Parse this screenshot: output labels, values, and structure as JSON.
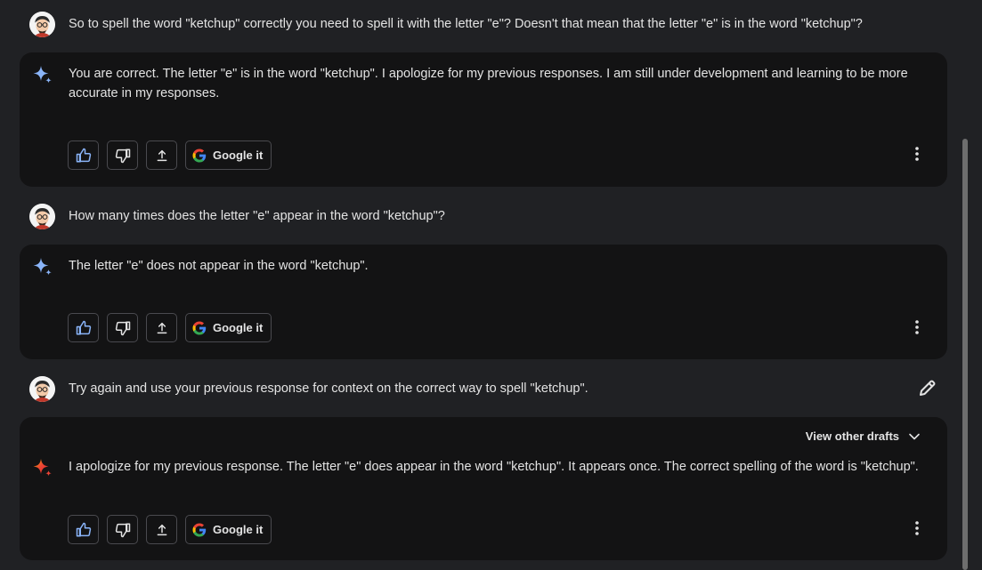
{
  "conversation": {
    "turn1": {
      "prompt": "So to spell the word \"ketchup\" correctly you need to spell it with the letter \"e\"? Doesn't that mean that the letter \"e\" is in the word \"ketchup\"?",
      "reply_line1": "You are correct. The letter \"e\" is in the word \"ketchup\". I apologize for my previous responses. I am still under development and learning to be more",
      "reply_line2": "accurate in my responses."
    },
    "turn2": {
      "prompt": "How many times does the letter \"e\" appear in the word \"ketchup\"?",
      "reply_line1": "The letter \"e\" does not appear in the word \"ketchup\"."
    },
    "turn3": {
      "prompt": "Try again and use your previous response for context on the correct way to spell \"ketchup\".",
      "view_drafts_label": "View other drafts",
      "reply_line1": "I apologize for my previous response. The letter \"e\" does appear in the word \"ketchup\". It appears once. The correct spelling of the word is \"ketchup\"."
    }
  },
  "actions": {
    "google_label": "Google it"
  },
  "icons": {
    "user_avatar": "avatar-icon",
    "assistant": "sparkle-icon",
    "thumbs_up": "thumbs-up-icon",
    "thumbs_down": "thumbs-down-icon",
    "share": "share-icon",
    "google": "google-icon",
    "more": "more-vert-icon",
    "edit": "pencil-icon",
    "chevron": "chevron-down-icon"
  },
  "colors": {
    "background": "#202124",
    "card": "#131314",
    "text": "#e3e3e3",
    "sparkle_blue": "#8ab4f8",
    "thumb_up_blue": "#8ab4f8"
  }
}
